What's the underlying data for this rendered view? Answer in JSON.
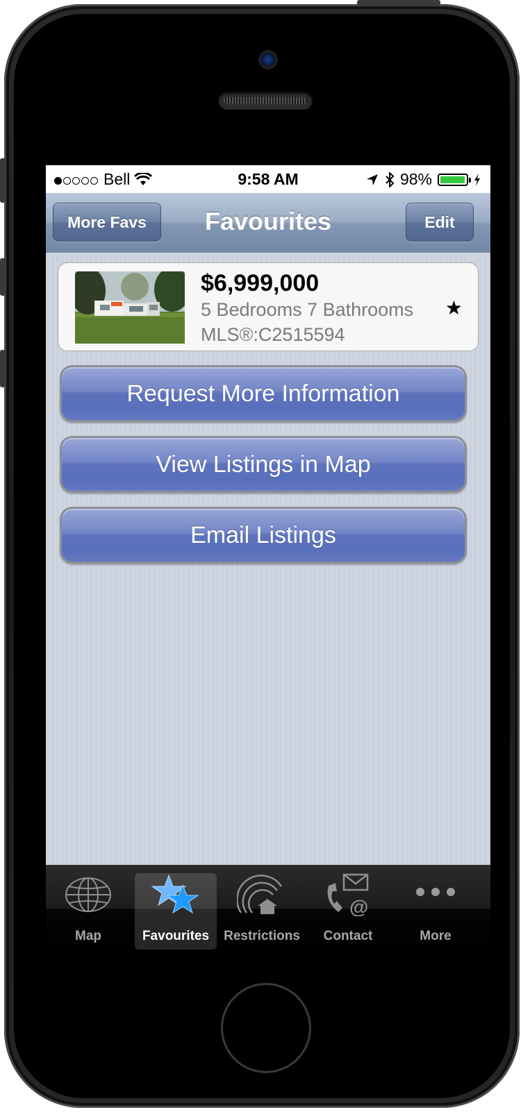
{
  "status_bar": {
    "carrier": "Bell",
    "time": "9:58 AM",
    "battery": "98%",
    "battery_level": 0.98
  },
  "navbar": {
    "left_button": "More Favs",
    "title": "Favourites",
    "right_button": "Edit"
  },
  "listing": {
    "price": "$6,999,000",
    "details": "5 Bedrooms 7 Bathrooms",
    "mls": "MLS®:C2515594",
    "favourite_icon": "★"
  },
  "actions": {
    "request_info": "Request More Information",
    "view_map": "View Listings in Map",
    "email": "Email Listings"
  },
  "tabbar": {
    "tabs": [
      {
        "label": "Map",
        "icon": "globe-icon"
      },
      {
        "label": "Favourites",
        "icon": "stars-icon",
        "active": true
      },
      {
        "label": "Restrictions",
        "icon": "house-radar-icon"
      },
      {
        "label": "Contact",
        "icon": "phone-mail-icon"
      },
      {
        "label": "More",
        "icon": "ellipsis-icon"
      }
    ]
  },
  "colors": {
    "button_blue": "#5e73bd",
    "nav_blue": "#8497b4",
    "battery_green": "#35c93e",
    "active_tab_star": "#3aa6ff"
  }
}
